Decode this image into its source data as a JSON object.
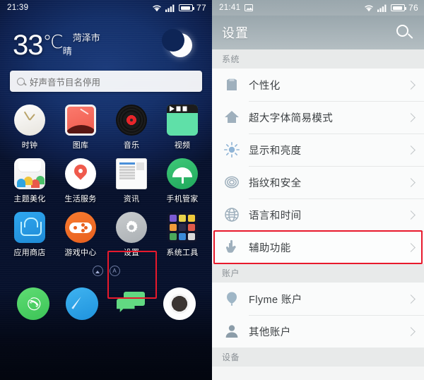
{
  "home": {
    "status_bar": {
      "time": "21:39",
      "battery_percent": "77",
      "wifi_icon": "wifi-icon",
      "signal_icon": "signal-icon",
      "battery_icon": "battery-icon"
    },
    "weather": {
      "temperature": "33",
      "degree_unit": "℃",
      "city": "菏泽市",
      "condition": "晴",
      "icon": "moon-icon"
    },
    "search": {
      "text": "好声音节目名停用",
      "icon": "search-icon"
    },
    "app_rows": [
      [
        {
          "label": "时钟",
          "icon": "clock-icon"
        },
        {
          "label": "图库",
          "icon": "gallery-icon"
        },
        {
          "label": "音乐",
          "icon": "music-icon"
        },
        {
          "label": "视频",
          "icon": "video-icon"
        }
      ],
      [
        {
          "label": "主题美化",
          "icon": "theme-icon"
        },
        {
          "label": "生活服务",
          "icon": "life-services-icon"
        },
        {
          "label": "资讯",
          "icon": "news-icon"
        },
        {
          "label": "手机管家",
          "icon": "phone-manager-icon"
        }
      ],
      [
        {
          "label": "应用商店",
          "icon": "app-store-icon"
        },
        {
          "label": "游戏中心",
          "icon": "game-center-icon"
        },
        {
          "label": "设置",
          "icon": "settings-gear-icon"
        },
        {
          "label": "系统工具",
          "icon": "system-tools-folder-icon"
        }
      ]
    ],
    "page_dots": [
      {
        "icon": "home-page-icon"
      },
      {
        "icon": "a-page-icon",
        "text": "A"
      }
    ],
    "dock": [
      {
        "name": "phone",
        "icon": "phone-icon"
      },
      {
        "name": "browser",
        "icon": "compass-browser-icon"
      },
      {
        "name": "messages",
        "icon": "message-bubble-icon"
      },
      {
        "name": "camera",
        "icon": "camera-icon"
      }
    ],
    "highlight_color": "#e8192c"
  },
  "settings": {
    "status_bar": {
      "time": "21:41",
      "battery_percent": "76",
      "photo_icon": "image-icon",
      "wifi_icon": "wifi-icon",
      "signal_icon": "signal-icon",
      "battery_icon": "battery-icon"
    },
    "header": {
      "title": "设置",
      "search_icon": "search-icon"
    },
    "sections": [
      {
        "title": "系统",
        "items": [
          {
            "label": "个性化",
            "icon": "shirt-icon",
            "highlighted": false
          },
          {
            "label": "超大字体简易模式",
            "icon": "home-icon",
            "highlighted": false
          },
          {
            "label": "显示和亮度",
            "icon": "brightness-sun-icon",
            "highlighted": false
          },
          {
            "label": "指纹和安全",
            "icon": "fingerprint-icon",
            "highlighted": false
          },
          {
            "label": "语言和时间",
            "icon": "globe-icon",
            "highlighted": false
          },
          {
            "label": "辅助功能",
            "icon": "hand-pointer-icon",
            "highlighted": true
          }
        ]
      },
      {
        "title": "账户",
        "items": [
          {
            "label": "Flyme 账户",
            "icon": "balloon-icon",
            "highlighted": false
          },
          {
            "label": "其他账户",
            "icon": "person-icon",
            "highlighted": false
          }
        ]
      },
      {
        "title": "设备",
        "items": []
      }
    ],
    "highlight_color": "#e8192c"
  }
}
